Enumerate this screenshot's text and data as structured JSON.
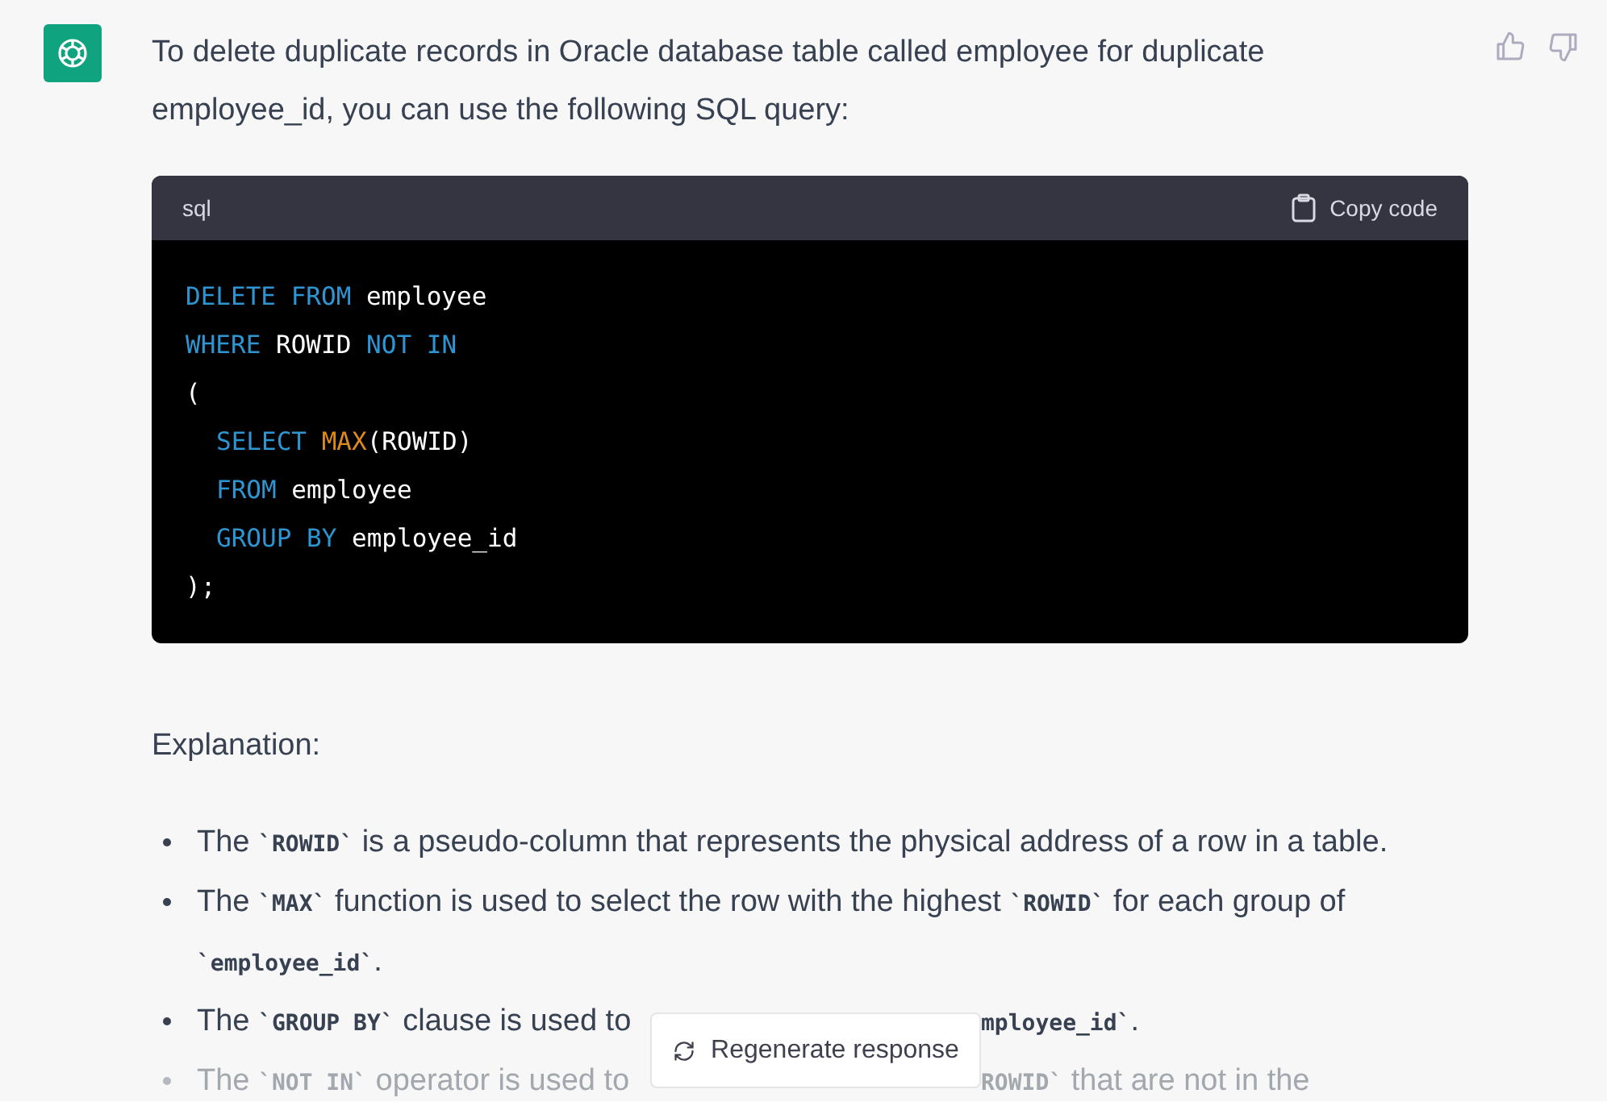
{
  "message": {
    "intro": "To delete duplicate records in Oracle database table called employee for duplicate employee_id, you can use the following SQL query:",
    "code_block": {
      "language": "sql",
      "copy_label": "Copy code",
      "lines": [
        {
          "indent": false,
          "tokens": [
            {
              "kind": "keyword",
              "text": "DELETE FROM"
            },
            {
              "kind": "plain",
              "text": "employee"
            }
          ]
        },
        {
          "indent": false,
          "tokens": [
            {
              "kind": "keyword",
              "text": "WHERE"
            },
            {
              "kind": "plain",
              "text": "ROWID"
            },
            {
              "kind": "keyword",
              "text": "NOT IN"
            }
          ]
        },
        {
          "indent": false,
          "tokens": [
            {
              "kind": "plain",
              "text": "("
            }
          ]
        },
        {
          "indent": true,
          "tokens": [
            {
              "kind": "keyword",
              "text": "SELECT"
            },
            {
              "kind": "function",
              "text": "MAX"
            },
            {
              "kind": "plain",
              "text": "(ROWID)",
              "glued": true
            }
          ]
        },
        {
          "indent": true,
          "tokens": [
            {
              "kind": "keyword",
              "text": "FROM"
            },
            {
              "kind": "plain",
              "text": "employee"
            }
          ]
        },
        {
          "indent": true,
          "tokens": [
            {
              "kind": "keyword",
              "text": "GROUP BY"
            },
            {
              "kind": "plain",
              "text": "employee_id"
            }
          ]
        },
        {
          "indent": false,
          "tokens": [
            {
              "kind": "plain",
              "text": ");"
            }
          ]
        }
      ]
    },
    "heading": "Explanation:",
    "bullets": [
      {
        "faded": false,
        "parts": [
          [
            {
              "text": "The "
            },
            {
              "text": "`ROWID`",
              "code": true
            },
            {
              "text": " is a pseudo-column that represents the physical address of a row in a table."
            }
          ]
        ]
      },
      {
        "faded": false,
        "parts": [
          [
            {
              "text": "The "
            },
            {
              "text": "`MAX`",
              "code": true
            },
            {
              "text": " function is used to select the row with the highest "
            },
            {
              "text": "`ROWID`",
              "code": true
            },
            {
              "text": " for each group of "
            },
            {
              "text": "`employee_id`",
              "code": true
            },
            {
              "text": "."
            }
          ]
        ]
      },
      {
        "faded": false,
        "parts": [
          [
            {
              "text": "The "
            },
            {
              "text": "`GROUP BY`",
              "code": true
            },
            {
              "text": " clause is used to"
            }
          ],
          [
            {
              "text": "mployee_id`",
              "code": true
            },
            {
              "text": "."
            }
          ]
        ]
      },
      {
        "faded": true,
        "parts": [
          [
            {
              "text": "The "
            },
            {
              "text": "`NOT IN`",
              "code": true
            },
            {
              "text": " operator is used to"
            }
          ],
          [
            {
              "text": "ROWID`",
              "code": true
            },
            {
              "text": " that are not in the"
            }
          ]
        ]
      }
    ]
  },
  "regenerate_button": "Regenerate response"
}
